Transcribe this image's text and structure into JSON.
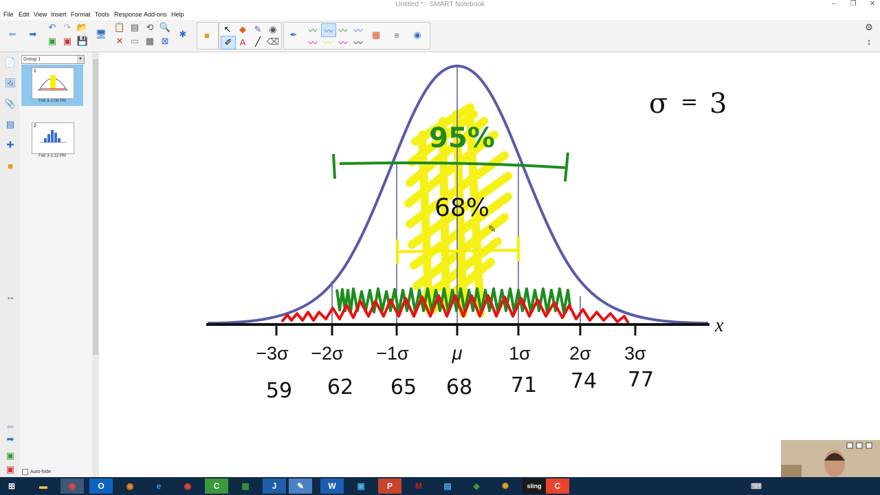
{
  "window": {
    "title": "Untitled * - SMART Notebook"
  },
  "menu": [
    "File",
    "Edit",
    "View",
    "Insert",
    "Format",
    "Tools",
    "Response",
    "Add-ons",
    "Help"
  ],
  "sorter": {
    "group": "Group 1",
    "pages": [
      {
        "number": "1",
        "timestamp": "Feb 3-1:08 PM"
      },
      {
        "number": "2",
        "timestamp": "Feb 3-1:12 PM"
      }
    ],
    "autohide_label": "Auto-hide"
  },
  "canvas": {
    "axis_label": "x",
    "sigma_labels": [
      "−3σ",
      "−2σ",
      "−1σ",
      "μ",
      "1σ",
      "2σ",
      "3σ"
    ],
    "values": [
      "59",
      "62",
      "65",
      "68",
      "71",
      "74",
      "77"
    ],
    "sigma_note": {
      "symbol": "σ",
      "equals": "=",
      "value": "3"
    },
    "pct_95": "95%",
    "pct_68": "68%",
    "colors": {
      "curve": "#5a5aa8",
      "green": "#1e8c1e",
      "yellow": "#f5f000",
      "red": "#e81212"
    }
  },
  "taskbar": {
    "apps": [
      "start-icon",
      "file-explorer-icon",
      "chrome-icon",
      "outlook-icon",
      "firefox-icon",
      "ie-icon",
      "chrome2-icon",
      "camtasia-icon",
      "spreadsheet-icon",
      "jet-icon",
      "notebook-icon",
      "word-icon",
      "screen-icon",
      "powerpoint-icon",
      "mendeley-icon",
      "remote-icon",
      "evernote-icon",
      "colorful-icon",
      "sling-icon",
      "camtasia-recorder-icon"
    ],
    "sling_label": "sling"
  }
}
